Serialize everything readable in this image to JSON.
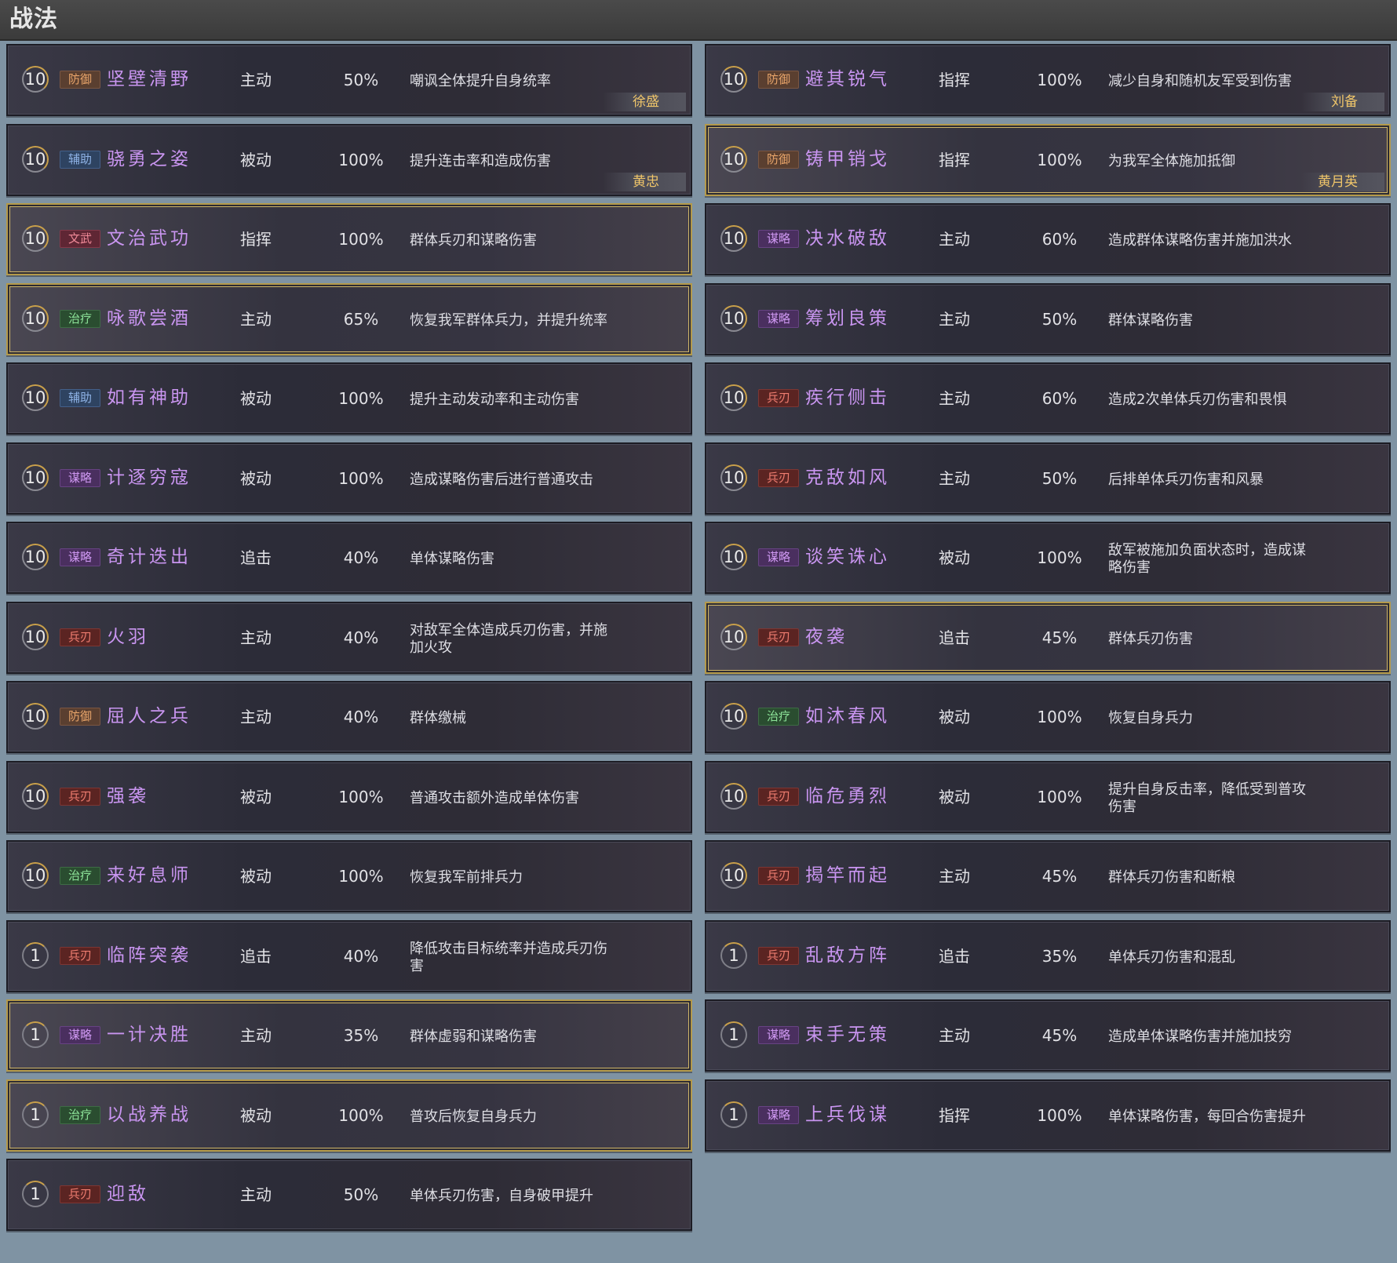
{
  "header": {
    "title": "战法"
  },
  "columns": [
    [
      {
        "level": "10",
        "category": "防御",
        "cat": "defense",
        "name": "坚壁清野",
        "type": "主动",
        "rate": "50%",
        "desc": "嘲讽全体提升自身统率",
        "hero": "徐盛",
        "gold": false
      },
      {
        "level": "10",
        "category": "辅助",
        "cat": "assist",
        "name": "骁勇之姿",
        "type": "被动",
        "rate": "100%",
        "desc": "提升连击率和造成伤害",
        "hero": "黄忠",
        "gold": false
      },
      {
        "level": "10",
        "category": "文武",
        "cat": "wenwu",
        "name": "文治武功",
        "type": "指挥",
        "rate": "100%",
        "desc": "群体兵刃和谋略伤害",
        "gold": true
      },
      {
        "level": "10",
        "category": "治疗",
        "cat": "heal",
        "name": "咏歌尝酒",
        "type": "主动",
        "rate": "65%",
        "desc": "恢复我军群体兵力，并提升统率",
        "gold": true
      },
      {
        "level": "10",
        "category": "辅助",
        "cat": "assist",
        "name": "如有神助",
        "type": "被动",
        "rate": "100%",
        "desc": "提升主动发动率和主动伤害",
        "gold": false
      },
      {
        "level": "10",
        "category": "谋略",
        "cat": "scheme",
        "name": "计逐穷寇",
        "type": "被动",
        "rate": "100%",
        "desc": "造成谋略伤害后进行普通攻击",
        "gold": false
      },
      {
        "level": "10",
        "category": "谋略",
        "cat": "scheme",
        "name": "奇计迭出",
        "type": "追击",
        "rate": "40%",
        "desc": "单体谋略伤害",
        "gold": false
      },
      {
        "level": "10",
        "category": "兵刃",
        "cat": "blade",
        "name": "火羽",
        "type": "主动",
        "rate": "40%",
        "desc": "对敌军全体造成兵刃伤害，并施加火攻",
        "gold": false
      },
      {
        "level": "10",
        "category": "防御",
        "cat": "defense",
        "name": "屈人之兵",
        "type": "主动",
        "rate": "40%",
        "desc": "群体缴械",
        "gold": false
      },
      {
        "level": "10",
        "category": "兵刃",
        "cat": "blade",
        "name": "强袭",
        "type": "被动",
        "rate": "100%",
        "desc": "普通攻击额外造成单体伤害",
        "gold": false
      },
      {
        "level": "10",
        "category": "治疗",
        "cat": "heal",
        "name": "来好息师",
        "type": "被动",
        "rate": "100%",
        "desc": "恢复我军前排兵力",
        "gold": false
      },
      {
        "level": "1",
        "category": "兵刃",
        "cat": "blade",
        "name": "临阵突袭",
        "type": "追击",
        "rate": "40%",
        "desc": "降低攻击目标统率并造成兵刃伤害",
        "gold": false
      },
      {
        "level": "1",
        "category": "谋略",
        "cat": "scheme",
        "name": "一计决胜",
        "type": "主动",
        "rate": "35%",
        "desc": "群体虚弱和谋略伤害",
        "gold": true
      },
      {
        "level": "1",
        "category": "治疗",
        "cat": "heal",
        "name": "以战养战",
        "type": "被动",
        "rate": "100%",
        "desc": "普攻后恢复自身兵力",
        "gold": true
      },
      {
        "level": "1",
        "category": "兵刃",
        "cat": "blade",
        "name": "迎敌",
        "type": "主动",
        "rate": "50%",
        "desc": "单体兵刃伤害，自身破甲提升",
        "gold": false
      }
    ],
    [
      {
        "level": "10",
        "category": "防御",
        "cat": "defense",
        "name": "避其锐气",
        "type": "指挥",
        "rate": "100%",
        "desc": "减少自身和随机友军受到伤害",
        "hero": "刘备",
        "gold": false
      },
      {
        "level": "10",
        "category": "防御",
        "cat": "defense",
        "name": "铸甲销戈",
        "type": "指挥",
        "rate": "100%",
        "desc": "为我军全体施加抵御",
        "hero": "黄月英",
        "gold": true
      },
      {
        "level": "10",
        "category": "谋略",
        "cat": "scheme",
        "name": "决水破敌",
        "type": "主动",
        "rate": "60%",
        "desc": "造成群体谋略伤害并施加洪水",
        "gold": false
      },
      {
        "level": "10",
        "category": "谋略",
        "cat": "scheme",
        "name": "筹划良策",
        "type": "主动",
        "rate": "50%",
        "desc": "群体谋略伤害",
        "gold": false
      },
      {
        "level": "10",
        "category": "兵刃",
        "cat": "blade",
        "name": "疾行侧击",
        "type": "主动",
        "rate": "60%",
        "desc": "造成2次单体兵刃伤害和畏惧",
        "gold": false
      },
      {
        "level": "10",
        "category": "兵刃",
        "cat": "blade",
        "name": "克敌如风",
        "type": "主动",
        "rate": "50%",
        "desc": "后排单体兵刃伤害和风暴",
        "gold": false
      },
      {
        "level": "10",
        "category": "谋略",
        "cat": "scheme",
        "name": "谈笑诛心",
        "type": "被动",
        "rate": "100%",
        "desc": "敌军被施加负面状态时，造成谋略伤害",
        "gold": false
      },
      {
        "level": "10",
        "category": "兵刃",
        "cat": "blade",
        "name": "夜袭",
        "type": "追击",
        "rate": "45%",
        "desc": "群体兵刃伤害",
        "gold": true
      },
      {
        "level": "10",
        "category": "治疗",
        "cat": "heal",
        "name": "如沐春风",
        "type": "被动",
        "rate": "100%",
        "desc": "恢复自身兵力",
        "gold": false
      },
      {
        "level": "10",
        "category": "兵刃",
        "cat": "blade",
        "name": "临危勇烈",
        "type": "被动",
        "rate": "100%",
        "desc": "提升自身反击率，降低受到普攻伤害",
        "gold": false
      },
      {
        "level": "10",
        "category": "兵刃",
        "cat": "blade",
        "name": "揭竿而起",
        "type": "主动",
        "rate": "45%",
        "desc": "群体兵刃伤害和断粮",
        "gold": false
      },
      {
        "level": "1",
        "category": "兵刃",
        "cat": "blade",
        "name": "乱敌方阵",
        "type": "追击",
        "rate": "35%",
        "desc": "单体兵刃伤害和混乱",
        "gold": false
      },
      {
        "level": "1",
        "category": "谋略",
        "cat": "scheme",
        "name": "束手无策",
        "type": "主动",
        "rate": "45%",
        "desc": "造成单体谋略伤害并施加技穷",
        "gold": false
      },
      {
        "level": "1",
        "category": "谋略",
        "cat": "scheme",
        "name": "上兵伐谋",
        "type": "指挥",
        "rate": "100%",
        "desc": "单体谋略伤害，每回合伤害提升",
        "gold": false
      }
    ]
  ]
}
